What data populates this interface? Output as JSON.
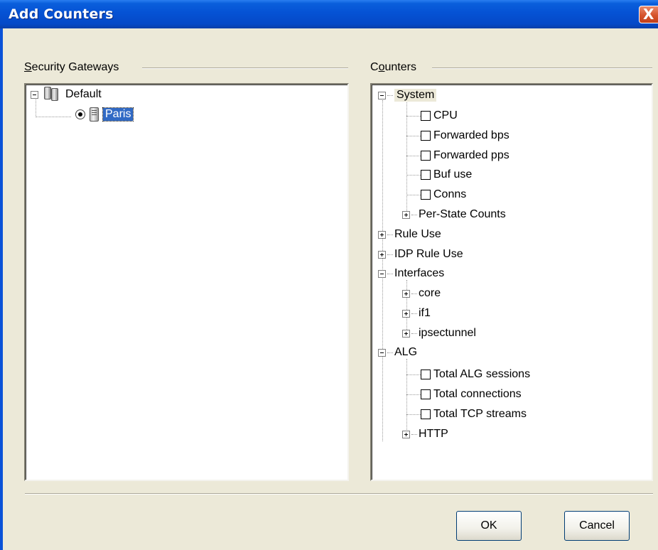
{
  "window": {
    "title": "Add Counters",
    "close_glyph": "X"
  },
  "left_group": {
    "label_first": "S",
    "label_rest": "ecurity Gateways",
    "tree": [
      {
        "label": "Default",
        "icon": "servers-icon",
        "expanded": true
      },
      {
        "label": "Paris",
        "icon": "server-icon",
        "selected": true,
        "radio_checked": true
      }
    ]
  },
  "right_group": {
    "label_first": "C",
    "label_mid": "o",
    "label_rest": "unters",
    "tree": {
      "system": "System",
      "cpu": "CPU",
      "forwarded_bps": "Forwarded bps",
      "forwarded_pps": "Forwarded pps",
      "buf_use": "Buf use",
      "conns": "Conns",
      "per_state_counts": "Per-State Counts",
      "rule_use": "Rule Use",
      "idp_rule_use": "IDP Rule Use",
      "interfaces": "Interfaces",
      "core": "core",
      "if1": "if1",
      "ipsectunnel": "ipsectunnel",
      "alg": "ALG",
      "total_alg_sessions": "Total ALG sessions",
      "total_connections": "Total connections",
      "total_tcp_streams": "Total TCP streams",
      "http": "HTTP"
    }
  },
  "buttons": {
    "ok": "OK",
    "cancel": "Cancel"
  }
}
